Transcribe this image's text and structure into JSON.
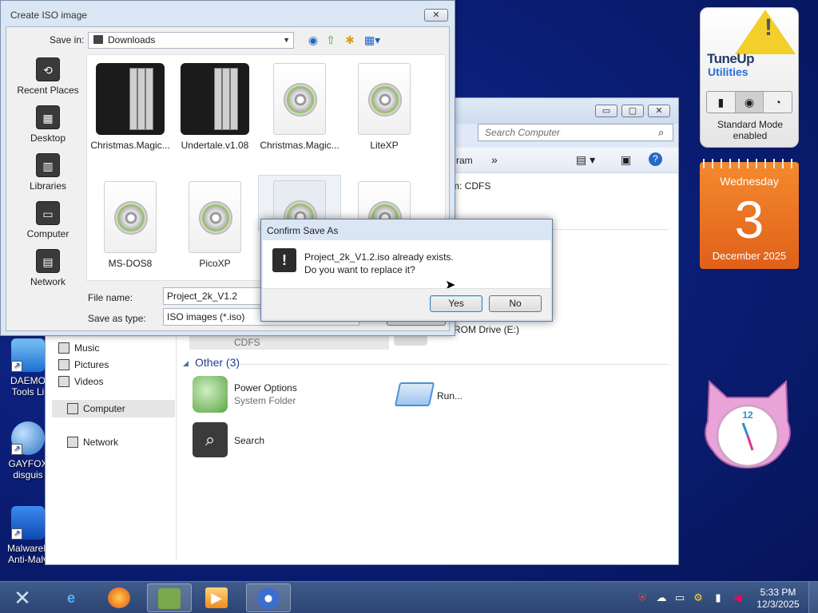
{
  "desktop_icons": [
    {
      "label": "DAEMO Tools Li",
      "icon": "daemon-tools-icon"
    },
    {
      "label": "GAYFOX disguis",
      "icon": "firefox-globe-icon"
    },
    {
      "label": "Malwareb Anti-Malv",
      "icon": "malwarebytes-icon"
    }
  ],
  "tuneup": {
    "title": "TuneUp",
    "subtitle": "Utilities",
    "status": "Standard Mode enabled",
    "modes": [
      "economy-mode-icon",
      "standard-mode-icon",
      "turbo-mode-icon"
    ]
  },
  "calendar": {
    "weekday": "Wednesday",
    "day": "3",
    "month_year": "December 2025"
  },
  "clock_gadget": {
    "numeral": "12"
  },
  "explorer": {
    "search_placeholder": "Search Computer",
    "toolbar_item": "ram",
    "toolbar_more": "»",
    "detail_text": "m: CDFS",
    "selected_drive_fs": "CDFS",
    "drive_label": "ROM Drive (E:)",
    "group_other": "Other (3)",
    "items": [
      {
        "name": "Power Options",
        "sub": "System Folder",
        "icon": "power-plug-icon"
      },
      {
        "name": "Run...",
        "sub": "",
        "icon": "run-icon"
      },
      {
        "name": "Search",
        "sub": "",
        "icon": "search-icon"
      }
    ],
    "nav": [
      {
        "label": "Music",
        "icon": "music-icon"
      },
      {
        "label": "Pictures",
        "icon": "pictures-icon"
      },
      {
        "label": "Videos",
        "icon": "videos-icon"
      },
      {
        "label": "Computer",
        "icon": "computer-icon"
      },
      {
        "label": "Network",
        "icon": "network-icon"
      }
    ],
    "buttons": {
      "minimize": "▭",
      "maximize": "▢",
      "close": "✕"
    }
  },
  "iso_dialog": {
    "title": "Create ISO image",
    "close": "✕",
    "save_in_label": "Save in:",
    "save_in_value": "Downloads",
    "places": [
      {
        "label": "Recent Places",
        "glyph": "⟲"
      },
      {
        "label": "Desktop",
        "glyph": "▦"
      },
      {
        "label": "Libraries",
        "glyph": "▥"
      },
      {
        "label": "Computer",
        "glyph": "▭"
      },
      {
        "label": "Network",
        "glyph": "▤"
      }
    ],
    "files": [
      {
        "name": "Christmas.Magic...",
        "kind": "dark"
      },
      {
        "name": "Undertale.v1.08",
        "kind": "dark"
      },
      {
        "name": "Christmas.Magic...",
        "kind": "disc"
      },
      {
        "name": "LiteXP",
        "kind": "disc"
      },
      {
        "name": "MS-DOS8",
        "kind": "disc"
      },
      {
        "name": "PicoXP",
        "kind": "disc"
      },
      {
        "name": "",
        "kind": "disc"
      },
      {
        "name": "",
        "kind": "disc"
      }
    ],
    "file_name_label": "File name:",
    "file_name_value": "Project_2k_V1.2",
    "save_type_label": "Save as type:",
    "save_type_value": "ISO images (*.iso)"
  },
  "confirm": {
    "title": "Confirm Save As",
    "line1": "Project_2k_V1.2.iso already exists.",
    "line2": "Do you want to replace it?",
    "yes": "Yes",
    "no": "No"
  },
  "taskbar": {
    "time": "5:33 PM",
    "date": "12/3/2025"
  }
}
